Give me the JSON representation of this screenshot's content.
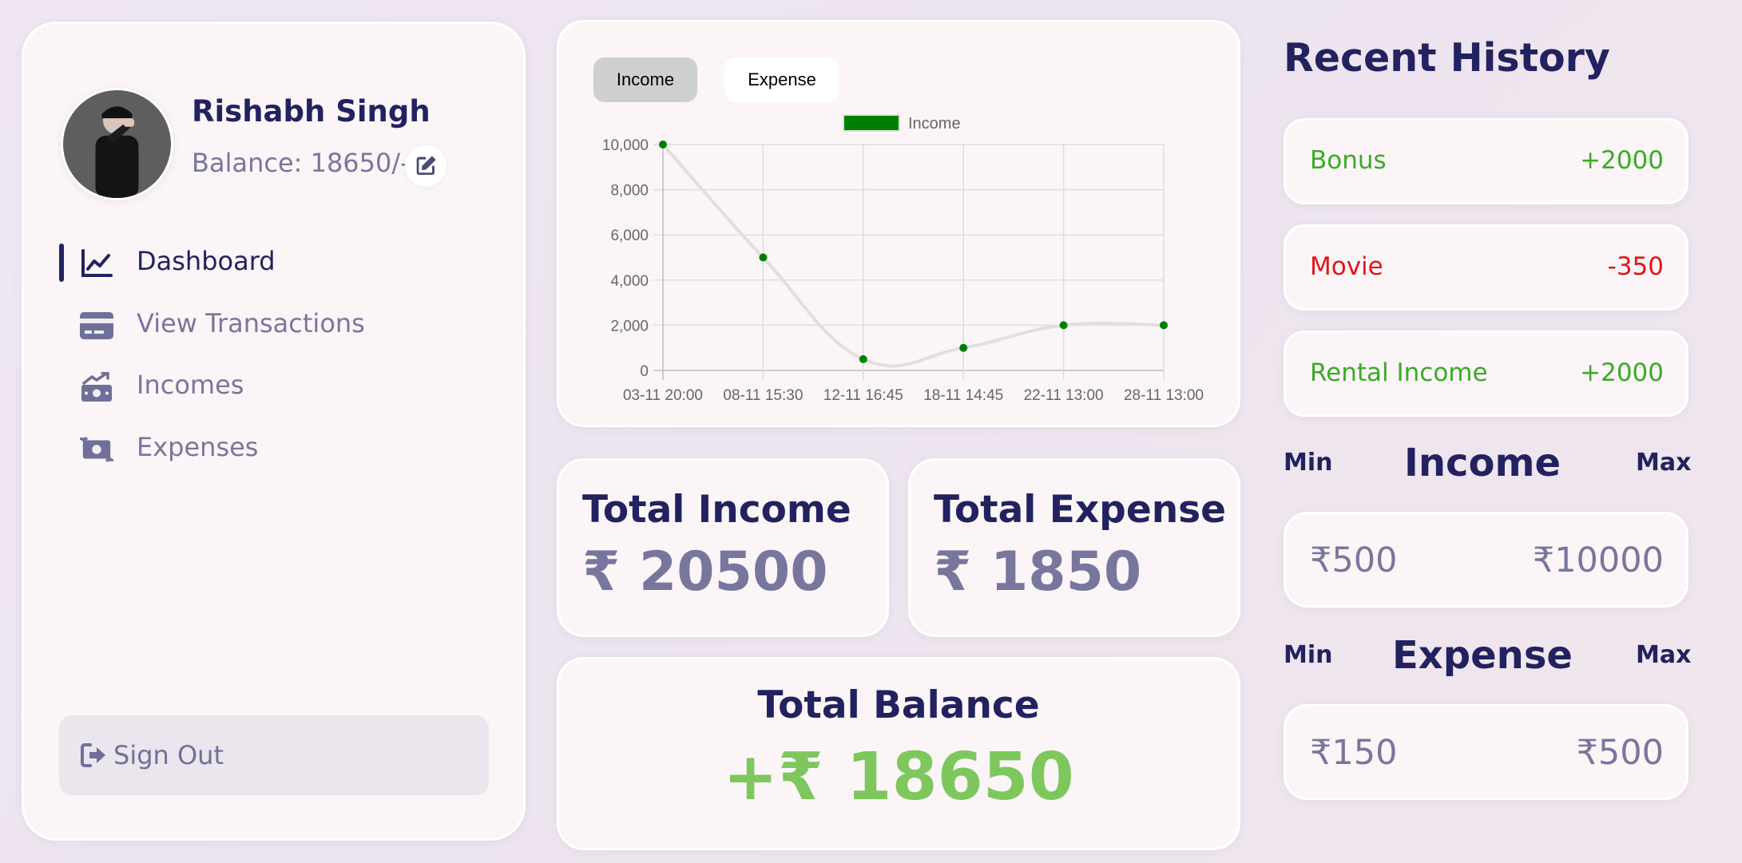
{
  "user": {
    "name": "Rishabh Singh",
    "balance_text": "Balance: 18650/-"
  },
  "menu": {
    "items": [
      {
        "label": "Dashboard",
        "icon": "line-chart-icon",
        "active": true
      },
      {
        "label": "View Transactions",
        "icon": "credit-card-icon",
        "active": false
      },
      {
        "label": "Incomes",
        "icon": "money-bill-trend-up-icon",
        "active": false
      },
      {
        "label": "Expenses",
        "icon": "money-bill-transfer-icon",
        "active": false
      }
    ],
    "sign_out": "Sign Out"
  },
  "chart_tabs": {
    "income": "Income",
    "expense": "Expense",
    "active": "Income"
  },
  "chart_data": {
    "type": "line",
    "categories": [
      "03-11 20:00",
      "08-11 15:30",
      "12-11 16:45",
      "18-11 14:45",
      "22-11 13:00",
      "28-11 13:00"
    ],
    "series": [
      {
        "name": "Income",
        "values": [
          10000,
          5000,
          500,
          1000,
          2000,
          2000
        ],
        "color": "#008000",
        "line_color": "#e0dede"
      }
    ],
    "yticks": [
      0,
      2000,
      4000,
      6000,
      8000,
      10000
    ],
    "ytick_labels": [
      "0",
      "2,000",
      "4,000",
      "6,000",
      "8,000",
      "10,000"
    ],
    "ylim": [
      0,
      10000
    ],
    "grid": true,
    "legend": "top-center"
  },
  "stats": {
    "income_title": "Total Income",
    "income_value": "₹ 20500",
    "expense_title": "Total Expense",
    "expense_value": "₹ 1850",
    "balance_title": "Total Balance",
    "balance_value": "+₹ 18650"
  },
  "history": {
    "title": "Recent History",
    "items": [
      {
        "name": "Bonus",
        "amount": "+2000",
        "type": "income"
      },
      {
        "name": "Movie",
        "amount": "-350",
        "type": "expense"
      },
      {
        "name": "Rental Income",
        "amount": "+2000",
        "type": "income"
      }
    ]
  },
  "ranges": {
    "min_label": "Min",
    "max_label": "Max",
    "income": {
      "title": "Income",
      "min": "₹500",
      "max": "₹10000"
    },
    "expense": {
      "title": "Expense",
      "min": "₹150",
      "max": "₹500"
    }
  },
  "colors": {
    "primary": "#222260",
    "income_green": "#3aab25",
    "expense_red": "#e01515",
    "balance_green": "#7dc75d"
  }
}
